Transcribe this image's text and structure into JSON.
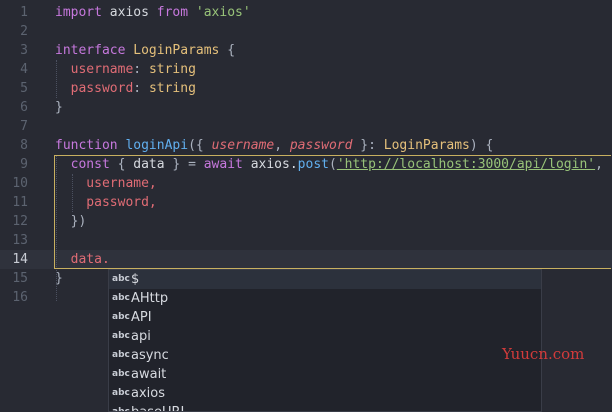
{
  "editor": {
    "current_line": "14",
    "lines": [
      {
        "n": "1",
        "tokens": [
          {
            "t": "import",
            "c": "kw"
          },
          {
            "t": " axios ",
            "c": "plain"
          },
          {
            "t": "from",
            "c": "kw"
          },
          {
            "t": " ",
            "c": "plain"
          },
          {
            "t": "'axios'",
            "c": "str"
          }
        ]
      },
      {
        "n": "2",
        "tokens": []
      },
      {
        "n": "3",
        "tokens": [
          {
            "t": "interface",
            "c": "kw"
          },
          {
            "t": " ",
            "c": "plain"
          },
          {
            "t": "LoginParams",
            "c": "type"
          },
          {
            "t": " {",
            "c": "punc"
          }
        ]
      },
      {
        "n": "4",
        "tokens": [
          {
            "t": "  username",
            "c": "prop"
          },
          {
            "t": ": ",
            "c": "punc"
          },
          {
            "t": "string",
            "c": "type"
          }
        ]
      },
      {
        "n": "5",
        "tokens": [
          {
            "t": "  password",
            "c": "prop"
          },
          {
            "t": ": ",
            "c": "punc"
          },
          {
            "t": "string",
            "c": "type"
          }
        ]
      },
      {
        "n": "6",
        "tokens": [
          {
            "t": "}",
            "c": "punc"
          }
        ]
      },
      {
        "n": "7",
        "tokens": []
      },
      {
        "n": "8",
        "tokens": [
          {
            "t": "function",
            "c": "kw"
          },
          {
            "t": " ",
            "c": "plain"
          },
          {
            "t": "loginApi",
            "c": "fn"
          },
          {
            "t": "({ ",
            "c": "punc"
          },
          {
            "t": "username",
            "c": "param"
          },
          {
            "t": ", ",
            "c": "punc"
          },
          {
            "t": "password",
            "c": "param"
          },
          {
            "t": " }: ",
            "c": "punc"
          },
          {
            "t": "LoginParams",
            "c": "type"
          },
          {
            "t": ") {",
            "c": "punc"
          }
        ]
      },
      {
        "n": "9",
        "tokens": [
          {
            "t": "  const",
            "c": "kw"
          },
          {
            "t": " { ",
            "c": "punc"
          },
          {
            "t": "data",
            "c": "plain"
          },
          {
            "t": " } = ",
            "c": "punc"
          },
          {
            "t": "await",
            "c": "kw"
          },
          {
            "t": " axios.",
            "c": "plain"
          },
          {
            "t": "post",
            "c": "fn"
          },
          {
            "t": "(",
            "c": "punc"
          },
          {
            "t": "'http://localhost:3000/api/login'",
            "c": "url"
          },
          {
            "t": ", {",
            "c": "punc"
          }
        ]
      },
      {
        "n": "10",
        "tokens": [
          {
            "t": "    username,",
            "c": "prop"
          }
        ]
      },
      {
        "n": "11",
        "tokens": [
          {
            "t": "    password,",
            "c": "prop"
          }
        ]
      },
      {
        "n": "12",
        "tokens": [
          {
            "t": "  })",
            "c": "punc"
          }
        ]
      },
      {
        "n": "13",
        "tokens": []
      },
      {
        "n": "14",
        "tokens": [
          {
            "t": "  data.",
            "c": "prop"
          }
        ]
      },
      {
        "n": "15",
        "tokens": [
          {
            "t": "}",
            "c": "punc"
          }
        ]
      },
      {
        "n": "16",
        "tokens": []
      }
    ]
  },
  "suggestions": {
    "kind_label": "abc",
    "items": [
      "$",
      "AHttp",
      "API",
      "api",
      "async",
      "await",
      "axios",
      "baseURL"
    ]
  },
  "watermark": "Yuucn.com",
  "colors": {
    "background": "#282a33",
    "keyword": "#c678dd",
    "function": "#61afef",
    "string": "#98c379",
    "property": "#e06c75",
    "type": "#e5c07b"
  }
}
